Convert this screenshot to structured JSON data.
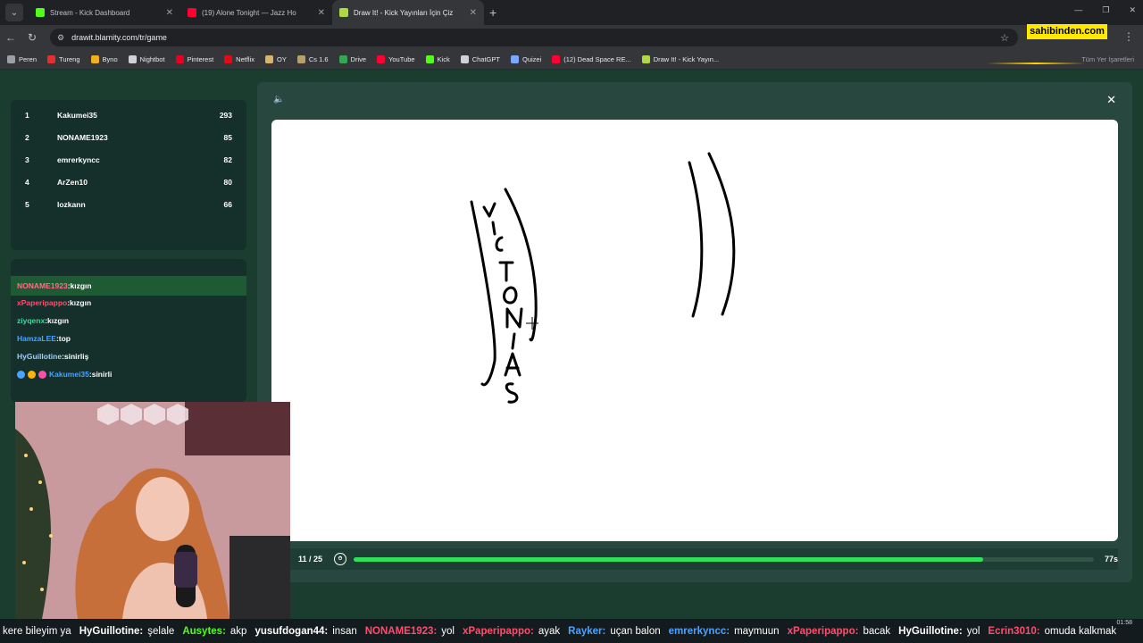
{
  "tabs": [
    {
      "title": "Stream - Kick Dashboard",
      "icon": "kick-icon",
      "color": "#53fc18"
    },
    {
      "title": "(19) Alone Tonight — Jazz Ho",
      "icon": "youtube-icon",
      "color": "#ff0033"
    },
    {
      "title": "Draw It! - Kick Yayınları İçin Çiz",
      "icon": "drawit-icon",
      "color": "#b0d845"
    }
  ],
  "url": "drawit.blamity.com/tr/game",
  "sahibinden": "sahibinden.com",
  "bookmarks": [
    {
      "label": "Peren",
      "color": "#9aa0a6"
    },
    {
      "label": "Tureng",
      "color": "#e0312e"
    },
    {
      "label": "Byno",
      "color": "#f2b01e"
    },
    {
      "label": "Nightbot",
      "color": "#cfd3d8"
    },
    {
      "label": "Pinterest",
      "color": "#e60023"
    },
    {
      "label": "Netflix",
      "color": "#e50914"
    },
    {
      "label": "OY",
      "color": "#d7b46a"
    },
    {
      "label": "Cs 1.6",
      "color": "#b9a06a"
    },
    {
      "label": "Drive",
      "color": "#34a853"
    },
    {
      "label": "YouTube",
      "color": "#ff0033"
    },
    {
      "label": "Kick",
      "color": "#53fc18"
    },
    {
      "label": "ChatGPT",
      "color": "#cfd3d8"
    },
    {
      "label": "Quizei",
      "color": "#7aa7ff"
    },
    {
      "label": "(12) Dead Space RE...",
      "color": "#ff0033"
    },
    {
      "label": "Draw It! - Kick Yayın...",
      "color": "#b0d845"
    }
  ],
  "bookmarks_all": "Tüm Yer İşaretleri",
  "leaderboard": [
    {
      "rank": "1",
      "name": "Kakumei35",
      "score": "293"
    },
    {
      "rank": "2",
      "name": "NONAME1923",
      "score": "85"
    },
    {
      "rank": "3",
      "name": "emrerkyncc",
      "score": "82"
    },
    {
      "rank": "4",
      "name": "ArZen10",
      "score": "80"
    },
    {
      "rank": "5",
      "name": "lozkann",
      "score": "66"
    }
  ],
  "chat": [
    {
      "user": "NONAME1923",
      "msg": ":kızgın",
      "color": "#ff6b8a"
    },
    {
      "user": "xPaperipappo",
      "msg": ":kızgın",
      "color": "#ff4d6d"
    },
    {
      "user": "ziyqenx",
      "msg": ":kızgın",
      "color": "#3ed6a0"
    },
    {
      "user": "HamzaLEE",
      "msg": ":top",
      "color": "#4aa3ff"
    },
    {
      "user": "HyGuillotine",
      "msg": ":sinirliş",
      "color": "#9fd0ff"
    },
    {
      "user": "Kakumei35",
      "msg": ":sinirli",
      "color": "#4aa3ff"
    }
  ],
  "game": {
    "round": "11 / 25",
    "time_left": "77s",
    "progress": 0.85
  },
  "ticker": [
    {
      "user": "",
      "msg": "kere bileyim ya",
      "color": "#ffffff"
    },
    {
      "user": "HyGuillotine:",
      "msg": "şelale",
      "color": "#ffffff"
    },
    {
      "user": "Ausytes:",
      "msg": "akp",
      "color": "#53fc18"
    },
    {
      "user": "yusufdogan44:",
      "msg": "insan",
      "color": "#ffffff"
    },
    {
      "user": "NONAME1923:",
      "msg": "yol",
      "color": "#ff4d6d"
    },
    {
      "user": "xPaperipappo:",
      "msg": "ayak",
      "color": "#ff4d6d"
    },
    {
      "user": "Rayker:",
      "msg": "uçan balon",
      "color": "#4aa3ff"
    },
    {
      "user": "emrerkyncc:",
      "msg": "maymuun",
      "color": "#4aa3ff"
    },
    {
      "user": "xPaperipappo:",
      "msg": "bacak",
      "color": "#ff4d6d"
    },
    {
      "user": "HyGuillotine:",
      "msg": "yol",
      "color": "#ffffff"
    },
    {
      "user": "Ecrin3010:",
      "msg": "omuda kalkmak",
      "color": "#ff4d6d"
    }
  ],
  "clock": "01:58"
}
